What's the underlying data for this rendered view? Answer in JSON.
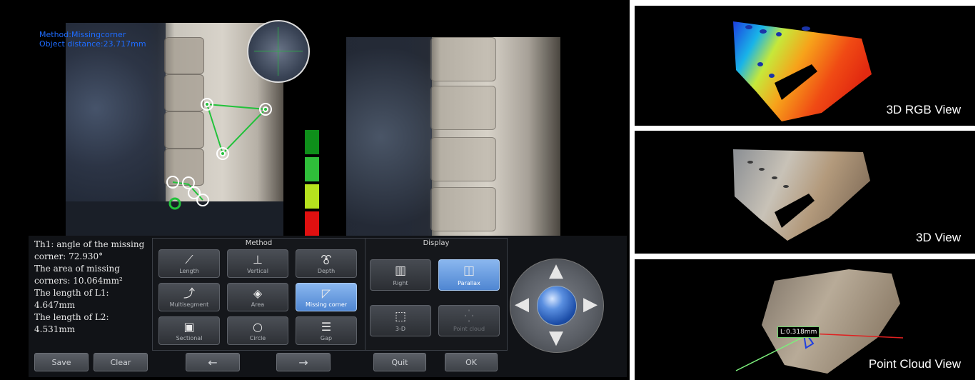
{
  "overlay": {
    "method_text": "Method:Missingcorner",
    "distance_text": "Object distance:23.717mm"
  },
  "results": {
    "lines": [
      "Th1: angle of the missing",
      "corner: 72.930°",
      "The area of missing",
      "corners: 10.064mm²",
      "The length of L1:",
      "4.647mm",
      "The length of L2:",
      "4.531mm"
    ]
  },
  "result_buttons": {
    "save": "Save",
    "clear": "Clear"
  },
  "method_panel": {
    "title": "Method",
    "buttons": [
      {
        "label": "Length",
        "icon": "length-icon",
        "glyph": "⟋"
      },
      {
        "label": "Vertical",
        "icon": "vertical-icon",
        "glyph": "⊥"
      },
      {
        "label": "Depth",
        "icon": "depth-icon",
        "glyph": "⯔"
      },
      {
        "label": "Multisegment",
        "icon": "multisegment-icon",
        "glyph": "⤴"
      },
      {
        "label": "Area",
        "icon": "area-icon",
        "glyph": "◈"
      },
      {
        "label": "Missing corner",
        "icon": "missing-corner-icon",
        "glyph": "◸"
      },
      {
        "label": "Sectional",
        "icon": "sectional-icon",
        "glyph": "▣"
      },
      {
        "label": "Circle",
        "icon": "circle-icon",
        "glyph": "○"
      },
      {
        "label": "Gap",
        "icon": "gap-icon",
        "glyph": "☰"
      }
    ],
    "active": "Missing corner"
  },
  "display_panel": {
    "title": "Display",
    "buttons": [
      {
        "label": "Right",
        "icon": "right-view-icon",
        "glyph": "▥"
      },
      {
        "label": "Parallax",
        "icon": "parallax-icon",
        "glyph": "◫"
      },
      {
        "label": "3-D",
        "icon": "cube-icon",
        "glyph": "⬚"
      },
      {
        "label": "Point cloud",
        "icon": "point-cloud-icon",
        "glyph": "⁛"
      }
    ],
    "active": "Parallax",
    "disabled": "Point cloud"
  },
  "nav_buttons": {
    "back": "←",
    "forward": "→"
  },
  "action_buttons": {
    "quit": "Quit",
    "ok": "OK"
  },
  "signal_bar": {
    "colors": [
      "#0e8f1a",
      "#2fbf3a",
      "#b6e21e",
      "#e01010"
    ]
  },
  "views": [
    {
      "label": "3D RGB View"
    },
    {
      "label": "3D View"
    },
    {
      "label": "Point Cloud View",
      "measurement": "L:0.318mm"
    }
  ]
}
